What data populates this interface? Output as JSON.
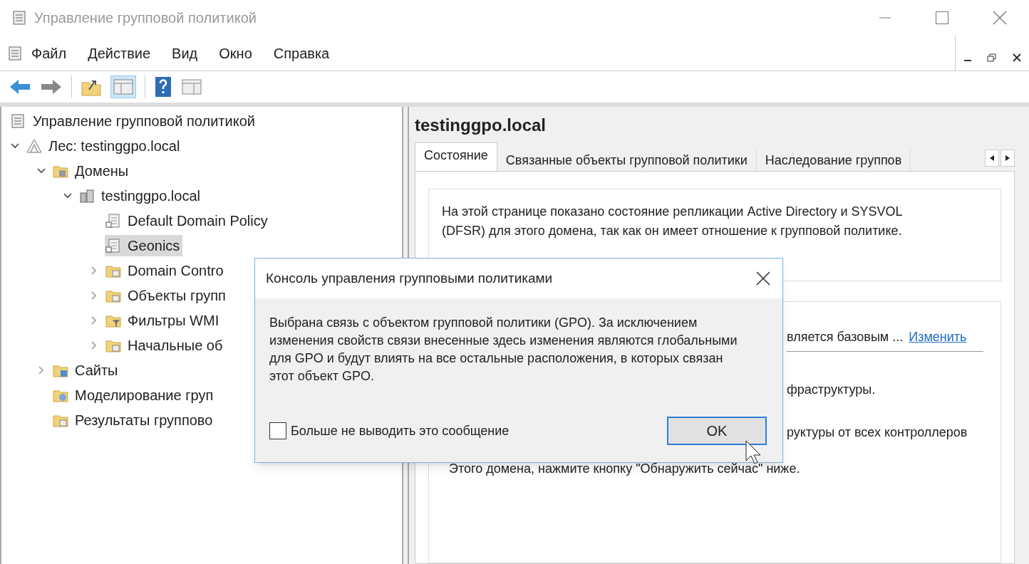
{
  "window": {
    "title": "Управление групповой политикой"
  },
  "menu": [
    "Файл",
    "Действие",
    "Вид",
    "Окно",
    "Справка"
  ],
  "tree": {
    "label": "Управление групповой политикой",
    "kind": "root",
    "children": [
      {
        "label": "Лес: testinggpo.local",
        "kind": "forest",
        "expanded": true,
        "selected": false,
        "children": [
          {
            "label": "Домены",
            "kind": "domains",
            "expanded": true,
            "selected": false,
            "children": [
              {
                "label": "testinggpo.local",
                "kind": "domain",
                "expanded": true,
                "selected": false,
                "children": [
                  {
                    "label": "Default Domain Policy",
                    "kind": "gpo",
                    "selected": false
                  },
                  {
                    "label": "Geonics",
                    "kind": "gpo",
                    "selected": true
                  },
                  {
                    "label": "Domain Contro",
                    "kind": "folder",
                    "expanded": false,
                    "selected": false
                  },
                  {
                    "label": "Объекты групп",
                    "kind": "gpofolder",
                    "expanded": false,
                    "selected": false
                  },
                  {
                    "label": "Фильтры WMI",
                    "kind": "filter",
                    "expanded": false,
                    "selected": false
                  },
                  {
                    "label": "Начальные об",
                    "kind": "starter",
                    "expanded": false,
                    "selected": false
                  }
                ]
              }
            ]
          },
          {
            "label": "Сайты",
            "kind": "sites",
            "expanded": false,
            "selected": false
          },
          {
            "label": "Моделирование груп",
            "kind": "modeling",
            "selected": false
          },
          {
            "label": "Результаты группово",
            "kind": "results",
            "selected": false
          }
        ]
      }
    ]
  },
  "details": {
    "title": "testinggpo.local",
    "tabs": [
      {
        "label": "Состояние",
        "selected": true
      },
      {
        "label": "Связанные объекты групповой политики",
        "selected": false
      },
      {
        "label": "Наследование группов",
        "selected": false
      }
    ],
    "intro": "На этой странице показано состояние репликации Active Directory и SYSVOL (DFSR) для этого домена, так как он имеет отношение к групповой политике.",
    "baseline": "вляется базовым ...",
    "change_link": "Изменить",
    "infra": "фраструктуры.",
    "controllers": "руктуры от всех контроллеров",
    "hint": "Этого домена, нажмите кнопку \"Обнаружить сейчас\" ниже."
  },
  "dialog": {
    "title": "Консоль управления групповыми политиками",
    "message": "Выбрана связь с объектом групповой политики (GPO). За исключением изменения свойств связи внесенные здесь изменения являются глобальными для GPO и будут влиять на все остальные расположения, в которых связан этот объект GPO.",
    "checkbox": {
      "label": "Больше не выводить это сообщение",
      "checked": false
    },
    "ok": "OK"
  }
}
